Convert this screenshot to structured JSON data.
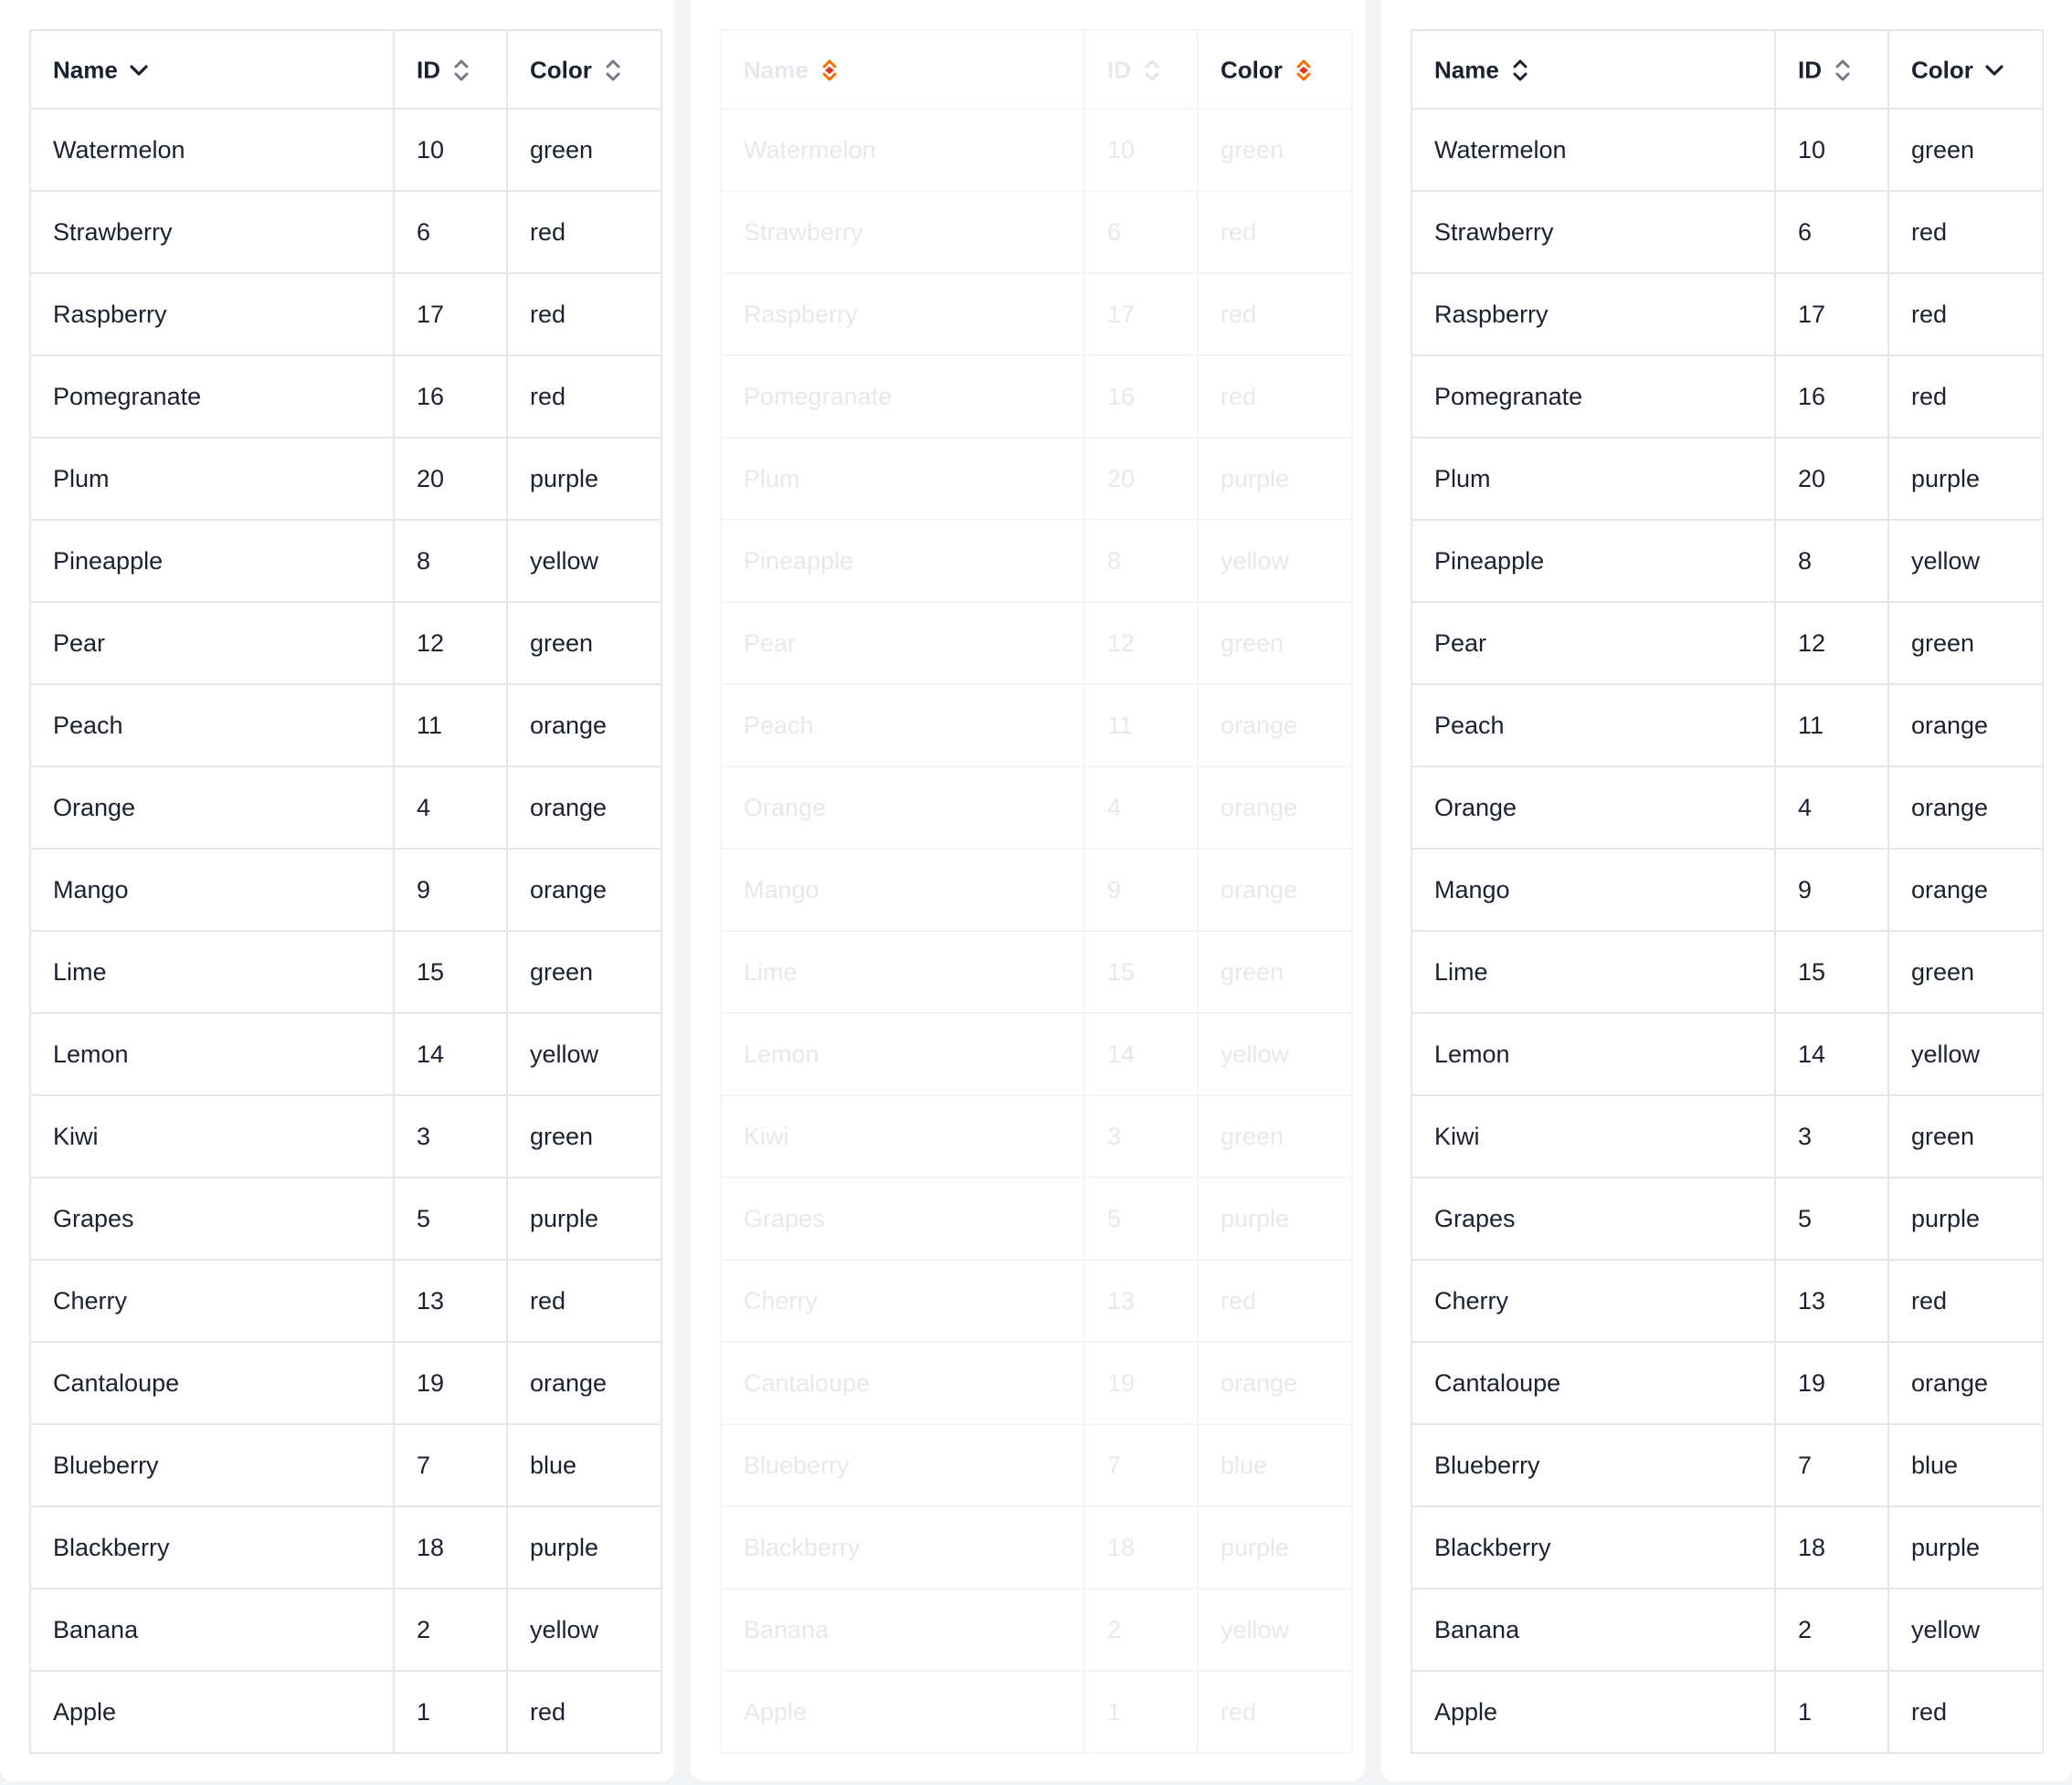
{
  "tables": [
    {
      "headers": {
        "name": "Name",
        "id": "ID",
        "color": "Color"
      },
      "sort": {
        "name": "desc-chevron",
        "id": "unsorted",
        "color": "unsorted"
      },
      "state": "normal"
    },
    {
      "headers": {
        "name": "Name",
        "id": "ID",
        "color": "Color"
      },
      "sort": {
        "name": "loading-orange",
        "id": "unsorted",
        "color": "loading-orange"
      },
      "state": "loading-faded"
    },
    {
      "headers": {
        "name": "Name",
        "id": "ID",
        "color": "Color"
      },
      "sort": {
        "name": "unsorted",
        "id": "unsorted",
        "color": "desc-chevron"
      },
      "state": "normal"
    }
  ],
  "rows": [
    {
      "name": "Watermelon",
      "id": "10",
      "color": "green"
    },
    {
      "name": "Strawberry",
      "id": "6",
      "color": "red"
    },
    {
      "name": "Raspberry",
      "id": "17",
      "color": "red"
    },
    {
      "name": "Pomegranate",
      "id": "16",
      "color": "red"
    },
    {
      "name": "Plum",
      "id": "20",
      "color": "purple"
    },
    {
      "name": "Pineapple",
      "id": "8",
      "color": "yellow"
    },
    {
      "name": "Pear",
      "id": "12",
      "color": "green"
    },
    {
      "name": "Peach",
      "id": "11",
      "color": "orange"
    },
    {
      "name": "Orange",
      "id": "4",
      "color": "orange"
    },
    {
      "name": "Mango",
      "id": "9",
      "color": "orange"
    },
    {
      "name": "Lime",
      "id": "15",
      "color": "green"
    },
    {
      "name": "Lemon",
      "id": "14",
      "color": "yellow"
    },
    {
      "name": "Kiwi",
      "id": "3",
      "color": "green"
    },
    {
      "name": "Grapes",
      "id": "5",
      "color": "purple"
    },
    {
      "name": "Cherry",
      "id": "13",
      "color": "red"
    },
    {
      "name": "Cantaloupe",
      "id": "19",
      "color": "orange"
    },
    {
      "name": "Blueberry",
      "id": "7",
      "color": "blue"
    },
    {
      "name": "Blackberry",
      "id": "18",
      "color": "purple"
    },
    {
      "name": "Banana",
      "id": "2",
      "color": "yellow"
    },
    {
      "name": "Apple",
      "id": "1",
      "color": "red"
    }
  ],
  "colors": {
    "text": "#1b2130",
    "muted_header": "#737a86",
    "accent": "#ff6b00",
    "border": "#e4e6ea"
  }
}
